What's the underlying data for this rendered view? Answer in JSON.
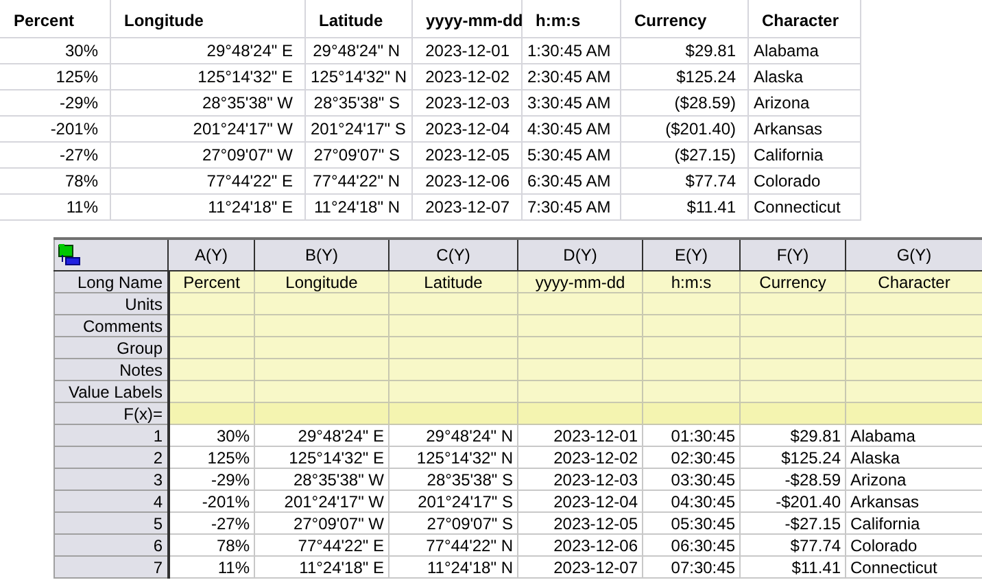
{
  "top_table": {
    "columns": [
      "Percent",
      "Longitude",
      "Latitude",
      "yyyy-mm-dd",
      "h:m:s",
      "Currency",
      "Character"
    ],
    "rows": [
      [
        "30%",
        "29°48'24\" E",
        "29°48'24\" N",
        "2023-12-01",
        "1:30:45 AM",
        "$29.81",
        "Alabama"
      ],
      [
        "125%",
        "125°14'32\" E",
        "125°14'32\" N",
        "2023-12-02",
        "2:30:45 AM",
        "$125.24",
        "Alaska"
      ],
      [
        "-29%",
        "28°35'38\" W",
        "28°35'38\" S",
        "2023-12-03",
        "3:30:45 AM",
        "($28.59)",
        "Arizona"
      ],
      [
        "-201%",
        "201°24'17\" W",
        "201°24'17\" S",
        "2023-12-04",
        "4:30:45 AM",
        "($201.40)",
        "Arkansas"
      ],
      [
        "-27%",
        "27°09'07\" W",
        "27°09'07\" S",
        "2023-12-05",
        "5:30:45 AM",
        "($27.15)",
        "California"
      ],
      [
        "78%",
        "77°44'22\" E",
        "77°44'22\" N",
        "2023-12-06",
        "6:30:45 AM",
        "$77.74",
        "Colorado"
      ],
      [
        "11%",
        "11°24'18\" E",
        "11°24'18\" N",
        "2023-12-07",
        "7:30:45 AM",
        "$11.41",
        "Connecticut"
      ]
    ]
  },
  "worksheet": {
    "columns": [
      "A(Y)",
      "B(Y)",
      "C(Y)",
      "D(Y)",
      "E(Y)",
      "F(Y)",
      "G(Y)"
    ],
    "label_rows": [
      {
        "label": "Long Name",
        "kind": "meta",
        "values": [
          "Percent",
          "Longitude",
          "Latitude",
          "yyyy-mm-dd",
          "h:m:s",
          "Currency",
          "Character"
        ]
      },
      {
        "label": "Units",
        "kind": "meta"
      },
      {
        "label": "Comments",
        "kind": "meta"
      },
      {
        "label": "Group",
        "kind": "meta"
      },
      {
        "label": "Notes",
        "kind": "meta"
      },
      {
        "label": "Value Labels",
        "kind": "meta"
      },
      {
        "label": "F(x)=",
        "kind": "formula"
      }
    ],
    "rows": [
      {
        "number": "1",
        "cells": [
          "30%",
          "29°48'24\" E",
          "29°48'24\" N",
          "2023-12-01",
          "01:30:45",
          "$29.81",
          "Alabama"
        ]
      },
      {
        "number": "2",
        "cells": [
          "125%",
          "125°14'32\" E",
          "125°14'32\" N",
          "2023-12-02",
          "02:30:45",
          "$125.24",
          "Alaska"
        ]
      },
      {
        "number": "3",
        "cells": [
          "-29%",
          "28°35'38\" W",
          "28°35'38\" S",
          "2023-12-03",
          "03:30:45",
          "-$28.59",
          "Arizona"
        ]
      },
      {
        "number": "4",
        "cells": [
          "-201%",
          "201°24'17\" W",
          "201°24'17\" S",
          "2023-12-04",
          "04:30:45",
          "-$201.40",
          "Arkansas"
        ]
      },
      {
        "number": "5",
        "cells": [
          "-27%",
          "27°09'07\" W",
          "27°09'07\" S",
          "2023-12-05",
          "05:30:45",
          "-$27.15",
          "California"
        ]
      },
      {
        "number": "6",
        "cells": [
          "78%",
          "77°44'22\" E",
          "77°44'22\" N",
          "2023-12-06",
          "06:30:45",
          "$77.74",
          "Colorado"
        ]
      },
      {
        "number": "7",
        "cells": [
          "11%",
          "11°24'18\" E",
          "11°24'18\" N",
          "2023-12-07",
          "07:30:45",
          "$11.41",
          "Connecticut"
        ]
      }
    ]
  }
}
